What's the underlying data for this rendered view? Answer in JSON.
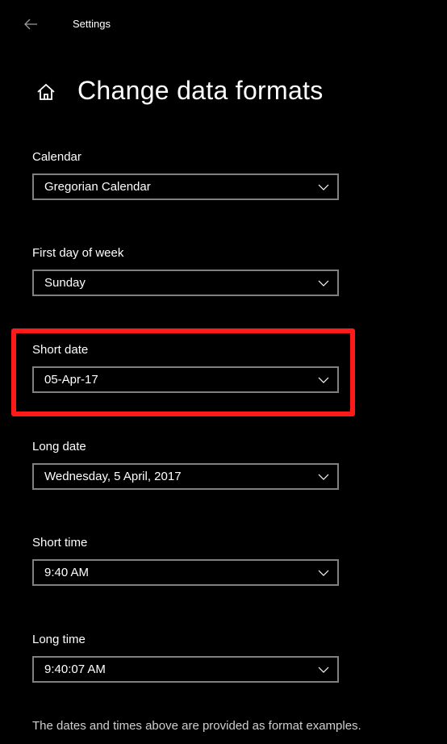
{
  "window": {
    "title": "Settings"
  },
  "page": {
    "title": "Change data formats"
  },
  "fields": {
    "calendar": {
      "label": "Calendar",
      "value": "Gregorian Calendar"
    },
    "first_day": {
      "label": "First day of week",
      "value": "Sunday"
    },
    "short_date": {
      "label": "Short date",
      "value": "05-Apr-17"
    },
    "long_date": {
      "label": "Long date",
      "value": "Wednesday, 5 April, 2017"
    },
    "short_time": {
      "label": "Short time",
      "value": "9:40 AM"
    },
    "long_time": {
      "label": "Long time",
      "value": "9:40:07 AM"
    }
  },
  "footer": {
    "note": "The dates and times above are provided as format examples."
  },
  "icons": {
    "back": "back-arrow-icon",
    "home": "home-icon",
    "dropdown": "chevron-down-icon"
  },
  "colors": {
    "background": "#000000",
    "text": "#ffffff",
    "border": "#808080",
    "highlight": "#ff1a1a"
  }
}
